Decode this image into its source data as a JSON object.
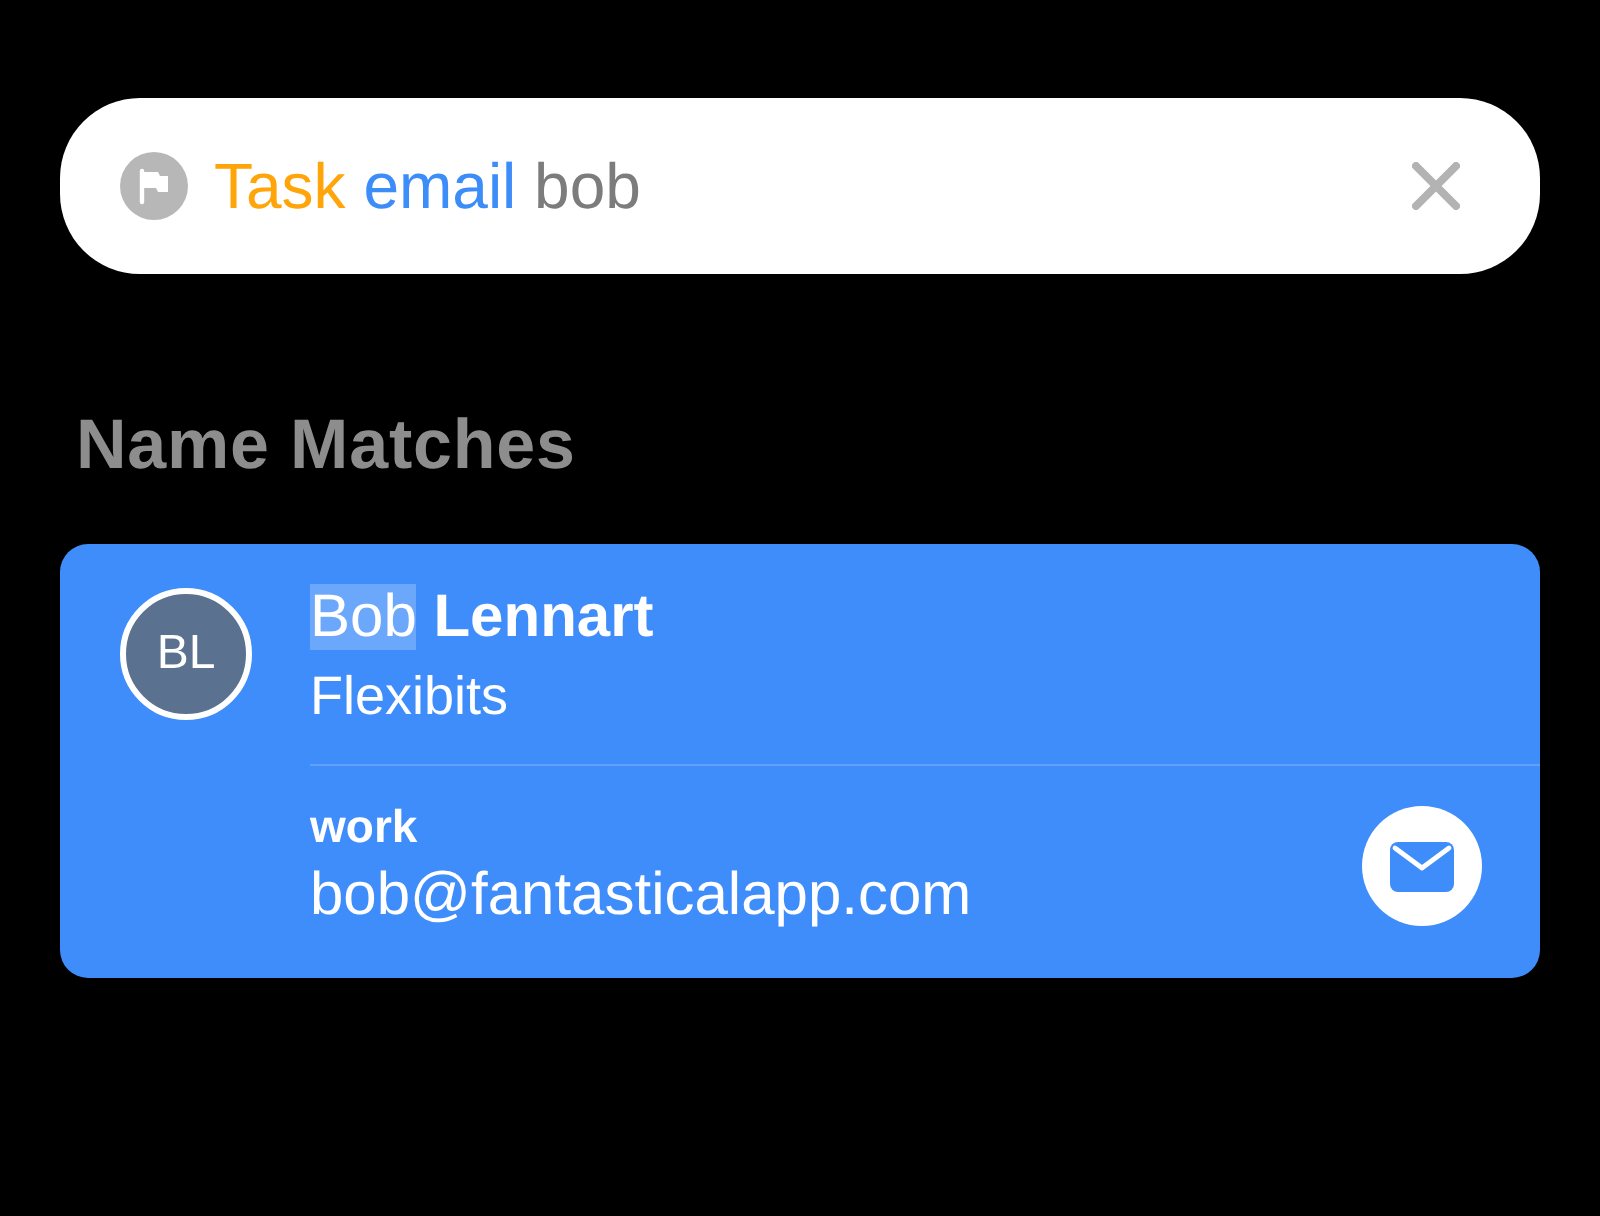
{
  "search": {
    "tokens": [
      {
        "text": "Task",
        "color": "#ffa50a"
      },
      {
        "text": "email",
        "color": "#3d8df8"
      },
      {
        "text": "bob",
        "color": "#7c7c7c"
      }
    ]
  },
  "section": {
    "title": "Name Matches"
  },
  "contacts": [
    {
      "initials": "BL",
      "name": [
        {
          "text": "Bob",
          "matched": true,
          "bold": false
        },
        {
          "text": "Lennart",
          "matched": false,
          "bold": true
        }
      ],
      "organization": "Flexibits",
      "emails": [
        {
          "label": "work",
          "address": "bob@fantasticalapp.com"
        }
      ]
    }
  ]
}
